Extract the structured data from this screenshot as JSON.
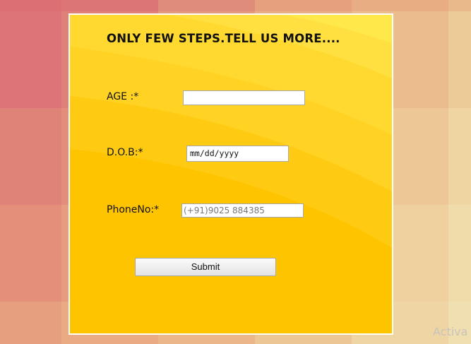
{
  "form": {
    "title": "ONLY FEW STEPS.TELL US MORE....",
    "age": {
      "label": "AGE :*",
      "value": ""
    },
    "dob": {
      "label": "D.O.B:*",
      "placeholder": "mm/dd/yyyy"
    },
    "phone": {
      "label": "PhoneNo:*",
      "placeholder": "(+91)9025 884385"
    },
    "submit_label": "Submit"
  },
  "watermark": "Activa",
  "colors": {
    "card_base": "#ffcf21",
    "card_highlight": "#ffe84a",
    "card_deep": "#ffc400",
    "card_border": "#ffffff",
    "background": "#e7a17c"
  }
}
